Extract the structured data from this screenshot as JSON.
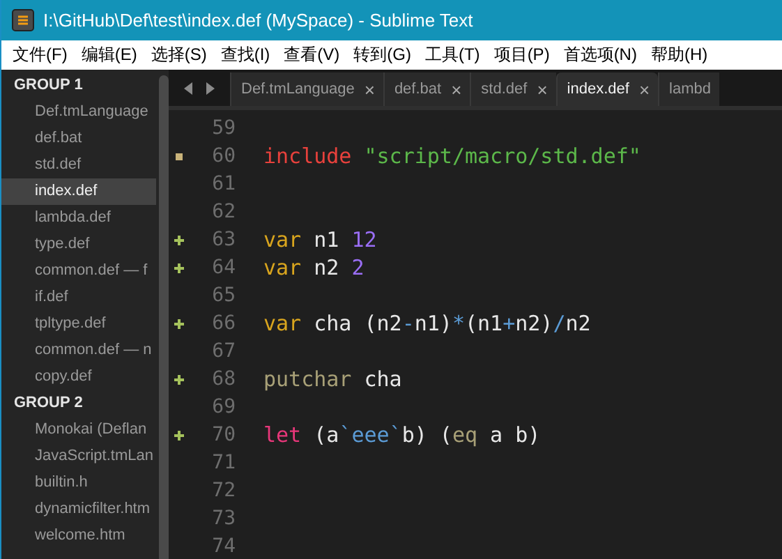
{
  "window": {
    "title": "I:\\GitHub\\Def\\test\\index.def (MySpace) - Sublime Text"
  },
  "menu": [
    "文件(F)",
    "编辑(E)",
    "选择(S)",
    "查找(I)",
    "查看(V)",
    "转到(G)",
    "工具(T)",
    "项目(P)",
    "首选项(N)",
    "帮助(H)"
  ],
  "sidebar": {
    "groups": [
      {
        "title": "GROUP 1",
        "items": [
          {
            "label": "Def.tmLanguage",
            "selected": false
          },
          {
            "label": "def.bat",
            "selected": false
          },
          {
            "label": "std.def",
            "selected": false
          },
          {
            "label": "index.def",
            "selected": true
          },
          {
            "label": "lambda.def",
            "selected": false
          },
          {
            "label": "type.def",
            "selected": false
          },
          {
            "label": "common.def — f",
            "selected": false
          },
          {
            "label": "if.def",
            "selected": false
          },
          {
            "label": "tpltype.def",
            "selected": false
          },
          {
            "label": "common.def — n",
            "selected": false
          },
          {
            "label": "copy.def",
            "selected": false
          }
        ]
      },
      {
        "title": "GROUP 2",
        "items": [
          {
            "label": "Monokai (Deflan",
            "selected": false
          },
          {
            "label": "JavaScript.tmLan",
            "selected": false
          },
          {
            "label": "builtin.h",
            "selected": false
          },
          {
            "label": "dynamicfilter.htm",
            "selected": false
          },
          {
            "label": "welcome.htm",
            "selected": false
          }
        ]
      }
    ]
  },
  "tabs": [
    {
      "label": "Def.tmLanguage",
      "selected": false,
      "close": "×"
    },
    {
      "label": "def.bat",
      "selected": false,
      "close": "×"
    },
    {
      "label": "std.def",
      "selected": false,
      "close": "×"
    },
    {
      "label": "index.def",
      "selected": true,
      "close": "×"
    },
    {
      "label": "lambd",
      "selected": false
    }
  ],
  "editor": {
    "lines": [
      {
        "number": "59",
        "modified": false,
        "added": false
      },
      {
        "number": "60",
        "modified": true,
        "added": false,
        "tokens": [
          {
            "kind": "keyword",
            "text": "include"
          },
          {
            "kind": "string",
            "text": " \"script/macro/std.def\""
          }
        ]
      },
      {
        "number": "61",
        "modified": false,
        "added": false
      },
      {
        "number": "62",
        "modified": false,
        "added": false
      },
      {
        "number": "63",
        "modified": false,
        "added": true,
        "tokens": [
          {
            "kind": "storage",
            "text": "var"
          },
          {
            "kind": "plain",
            "text": " n1 "
          },
          {
            "kind": "number",
            "text": "12"
          }
        ]
      },
      {
        "number": "64",
        "modified": false,
        "added": true,
        "tokens": [
          {
            "kind": "storage",
            "text": "var"
          },
          {
            "kind": "plain",
            "text": " n2 "
          },
          {
            "kind": "number",
            "text": "2"
          }
        ]
      },
      {
        "number": "65",
        "modified": false,
        "added": false
      },
      {
        "number": "66",
        "modified": false,
        "added": true,
        "tokens": [
          {
            "kind": "storage",
            "text": "var"
          },
          {
            "kind": "plain",
            "text": " cha (n2"
          },
          {
            "kind": "operator",
            "text": "-"
          },
          {
            "kind": "plain",
            "text": "n1)"
          },
          {
            "kind": "operator",
            "text": "*"
          },
          {
            "kind": "plain",
            "text": "(n1"
          },
          {
            "kind": "operator",
            "text": "+"
          },
          {
            "kind": "plain",
            "text": "n2)"
          },
          {
            "kind": "operator",
            "text": "/"
          },
          {
            "kind": "plain",
            "text": "n2"
          }
        ]
      },
      {
        "number": "67",
        "modified": false,
        "added": false
      },
      {
        "number": "68",
        "modified": false,
        "added": true,
        "tokens": [
          {
            "kind": "function",
            "text": "putchar"
          },
          {
            "kind": "plain",
            "text": " cha"
          }
        ]
      },
      {
        "number": "69",
        "modified": false,
        "added": false
      },
      {
        "number": "70",
        "modified": false,
        "added": true,
        "tokens": [
          {
            "kind": "let",
            "text": "let"
          },
          {
            "kind": "plain",
            "text": " (a"
          },
          {
            "kind": "operator",
            "text": "`eee`"
          },
          {
            "kind": "plain",
            "text": "b) ("
          },
          {
            "kind": "function",
            "text": "eq"
          },
          {
            "kind": "plain",
            "text": " a b)"
          }
        ]
      },
      {
        "number": "71",
        "modified": false,
        "added": false
      },
      {
        "number": "72",
        "modified": false,
        "added": false
      },
      {
        "number": "73",
        "modified": false,
        "added": false
      },
      {
        "number": "74",
        "modified": false,
        "added": false
      }
    ]
  }
}
